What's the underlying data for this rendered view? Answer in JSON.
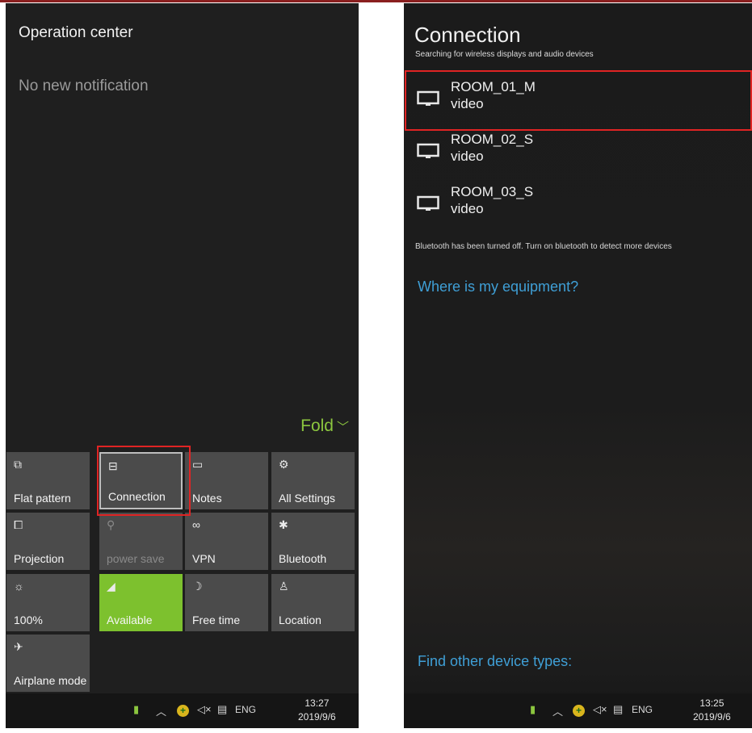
{
  "left": {
    "title": "Operation center",
    "empty_text": "No new notification",
    "fold": "Fold",
    "tiles": [
      {
        "icon": "⧉",
        "label": "Flat pattern"
      },
      {
        "icon": "⊟",
        "label": "Connection"
      },
      {
        "icon": "▭",
        "label": "Notes"
      },
      {
        "icon": "⚙",
        "label": "All Settings"
      },
      {
        "icon": "⧠",
        "label": "Projection"
      },
      {
        "icon": "⚲",
        "label": "power save"
      },
      {
        "icon": "∞",
        "label": "VPN"
      },
      {
        "icon": "✱",
        "label": "Bluetooth"
      },
      {
        "icon": "☼",
        "label": "100%"
      },
      {
        "icon": "◢",
        "label": "Available"
      },
      {
        "icon": "☽",
        "label": "Free time"
      },
      {
        "icon": "♙",
        "label": "Location"
      },
      {
        "icon": "✈",
        "label": "Airplane mode"
      }
    ],
    "taskbar": {
      "lang": "ENG",
      "time": "13:27",
      "date": "2019/9/6"
    }
  },
  "right": {
    "title": "Connection",
    "subtitle": "Searching for wireless displays and audio devices",
    "devices": [
      {
        "name": "ROOM_01_M",
        "type": "video"
      },
      {
        "name": "ROOM_02_S",
        "type": "video"
      },
      {
        "name": "ROOM_03_S",
        "type": "video"
      }
    ],
    "bt_note": "Bluetooth has been turned off. Turn on bluetooth to detect more devices",
    "where_link": "Where is my equipment?",
    "find_link": "Find other device types:",
    "taskbar": {
      "lang": "ENG",
      "time": "13:25",
      "date": "2019/9/6"
    }
  },
  "colors": {
    "accent_green": "#7dc12e",
    "link_blue": "#3f9fd6",
    "highlight_red": "#e02424"
  }
}
